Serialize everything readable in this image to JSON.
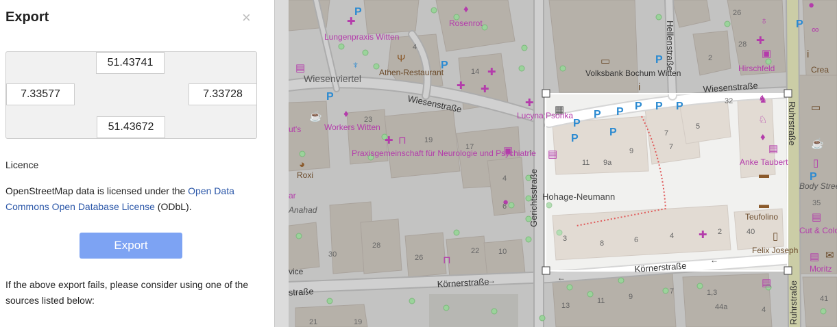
{
  "sidebar": {
    "title": "Export",
    "close_glyph": "×",
    "bbox": {
      "north": "51.43741",
      "west": "7.33577",
      "east": "7.33728",
      "south": "51.43672"
    },
    "licence_heading": "Licence",
    "licence_prefix": "OpenStreetMap data is licensed under the ",
    "licence_link": "Open Data Commons Open Database License",
    "licence_suffix": " (ODbL).",
    "export_label": "Export",
    "fail_text": "If the above export fails, please consider using one of the sources listed below:"
  },
  "map": {
    "streets": {
      "wiesenstrasse_w": "Wiesenstraße",
      "wiesenstrasse_e": "Wiesenstraße",
      "gerichtsstrasse": "Gerichtsstraße",
      "hellenstrasse": "Hellenstraße",
      "ruhrstrasse": "Ruhrstraße",
      "ruhrstrasse_s": "Ruhrstraße",
      "koernerstrasse_w": "Körnerstraße",
      "koernerstrasse_e": "Körnerstraße",
      "strasse_w": "straße"
    },
    "pois": {
      "lungenpraxis": "Lungenpraxis Witten",
      "wiesenviertel": "Wiesenviertel",
      "rosenrot": "Rosenrot",
      "athen": "Athen-Restaurant",
      "volksbank": "Volksbank Bochum Witten",
      "hirschfeld": "Hirschfeld",
      "crea": "Crea",
      "lucyna": "Lucyna Psonka",
      "workers": "Workers Witten",
      "praxis": "Praxisgemeinschaft für Neurologie und Psychiatrie",
      "hohage": "Hohage-Neumann",
      "anke": "Anke Taubert",
      "teufolino": "Teufolino",
      "felix": "Felix Joseph",
      "cut": "Cut & Colour",
      "body": "Body Street",
      "moritz": "Moritz",
      "roxi": "Roxi",
      "anahad": "Anahad",
      "uts": "ut's",
      "vice": "vice",
      "ar": "ar"
    },
    "numbers": {
      "n26": "26",
      "n28": "28",
      "n2a": "2",
      "n4a": "4",
      "n14": "14",
      "n23": "23",
      "n19": "19",
      "n17": "17",
      "n4b": "4",
      "n6": "6",
      "n28b": "28",
      "n30": "30",
      "n26b": "26",
      "n22": "22",
      "n10": "10",
      "n32": "32",
      "n7a": "7",
      "n5": "5",
      "n9a": "9",
      "n7b": "7",
      "n11": "11",
      "n9a2": "9a",
      "n3": "3",
      "n8": "8",
      "n6b": "6",
      "n4c": "4",
      "n2b": "2",
      "n40": "40",
      "n35": "35",
      "n13": "13",
      "n11b": "11",
      "n9b": "9",
      "n7c": "7",
      "n13b": "1,3",
      "n44a": "44a",
      "n4d": "4",
      "n41": "41",
      "n21": "21",
      "n19b": "19"
    },
    "colors": {
      "selection": "#ffffff",
      "dim": "#9e9e9e"
    }
  }
}
